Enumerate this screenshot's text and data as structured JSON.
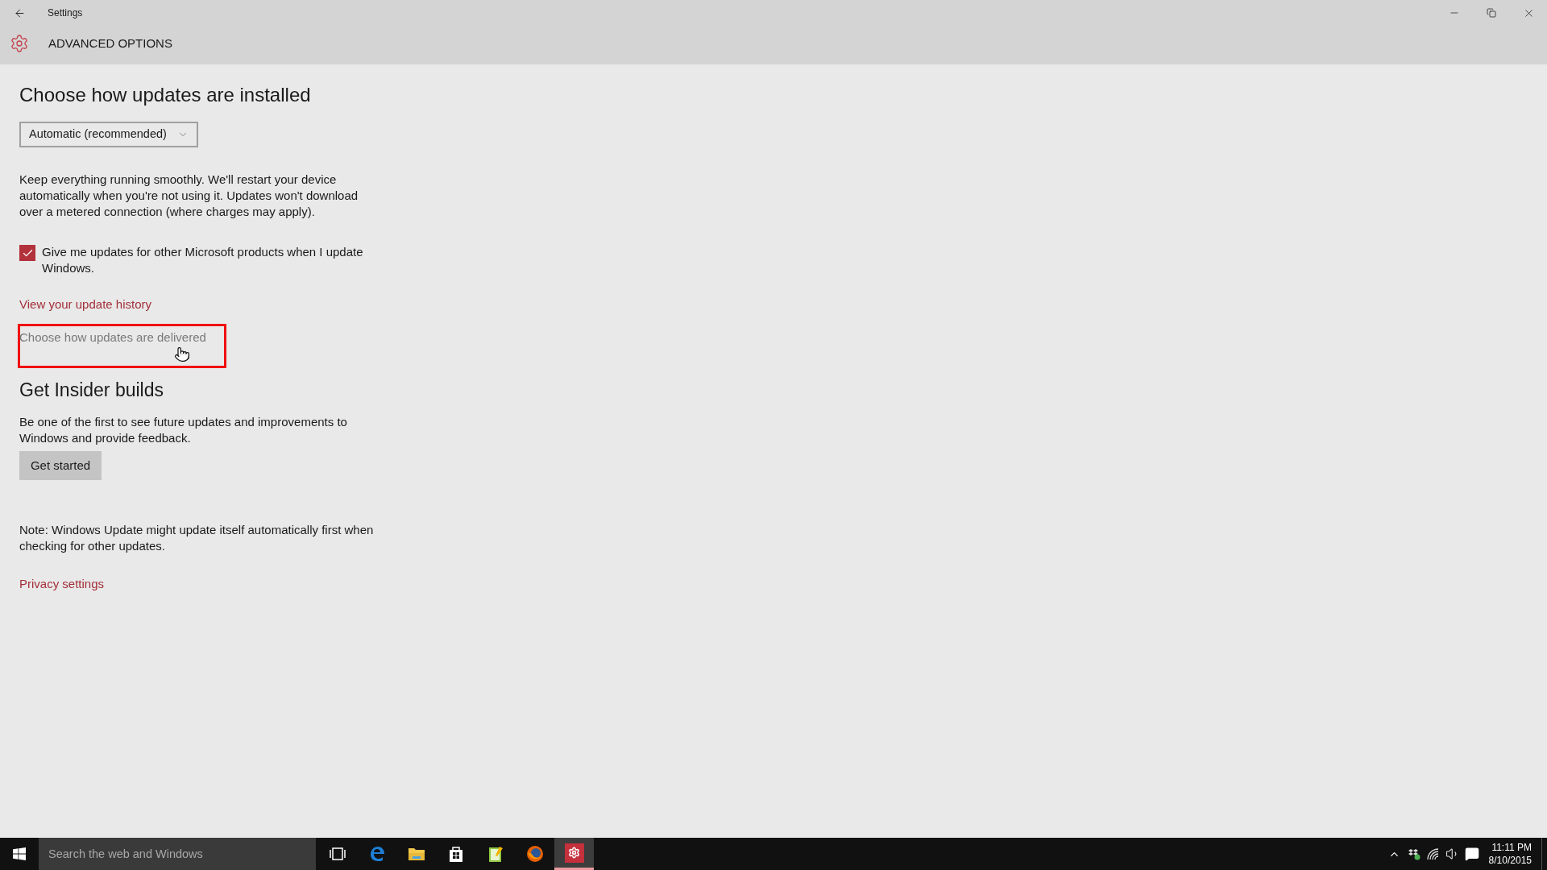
{
  "window": {
    "title": "Settings"
  },
  "page_header": {
    "title": "ADVANCED OPTIONS"
  },
  "install_section": {
    "heading": "Choose how updates are installed",
    "dropdown": {
      "value": "Automatic (recommended)"
    },
    "description": "Keep everything running smoothly. We'll restart your device automatically when you're not using it. Updates won't download over a metered connection (where charges may apply).",
    "checkbox": {
      "label": "Give me updates for other Microsoft products when I update Windows.",
      "checked": true
    },
    "links": [
      {
        "text": "View your update history",
        "highlighted": false
      },
      {
        "text": "Choose how updates are delivered",
        "highlighted": true
      }
    ]
  },
  "insider_section": {
    "heading": "Get Insider builds",
    "description": "Be one of the first to see future updates and improvements to Windows and provide feedback.",
    "button": "Get started"
  },
  "note": "Note: Windows Update might update itself automatically first when checking for other updates.",
  "privacy_link": "Privacy settings",
  "taskbar": {
    "search": {
      "placeholder": "Search the web and Windows"
    },
    "apps": [
      {
        "kind": "taskview",
        "selected": false
      },
      {
        "kind": "edge",
        "selected": false
      },
      {
        "kind": "explorer",
        "selected": false
      },
      {
        "kind": "store",
        "selected": false
      },
      {
        "kind": "notepad",
        "selected": false
      },
      {
        "kind": "firefox",
        "selected": false
      },
      {
        "kind": "settings",
        "selected": true
      }
    ],
    "clock": {
      "time": "11:11 PM",
      "date": "8/10/2015"
    }
  }
}
